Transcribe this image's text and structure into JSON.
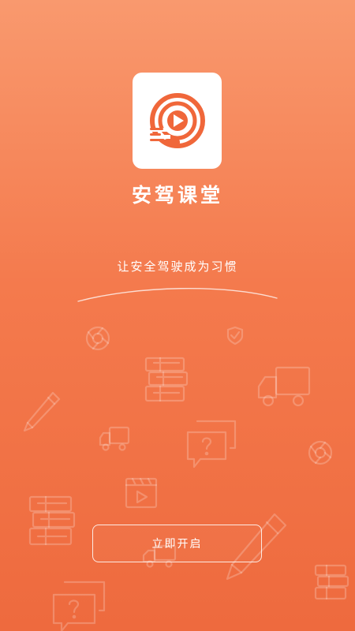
{
  "app": {
    "name": "安驾课堂",
    "slogan": "让安全驾驶成为习惯",
    "brand_color": "#f47a4d",
    "logo_icon": "play-circle-motion-icon"
  },
  "actions": {
    "start_label": "立即开启"
  },
  "background_icons": [
    "aperture-icon",
    "shield-icon",
    "books-icon",
    "truck-icon",
    "pencil-icon",
    "question-chat-icon",
    "video-icon"
  ]
}
